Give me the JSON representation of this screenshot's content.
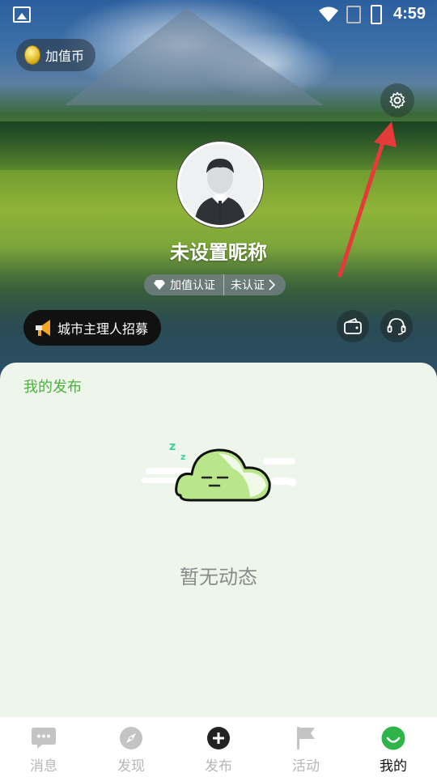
{
  "status_bar": {
    "time": "4:59"
  },
  "header": {
    "coin_label": "加值币",
    "nickname": "未设置昵称",
    "verify": {
      "label": "加值认证",
      "status": "未认证"
    },
    "recruit_label": "城市主理人招募"
  },
  "panel": {
    "title": "我的发布",
    "empty_text": "暂无动态"
  },
  "nav": [
    {
      "label": "消息",
      "icon": "chat-bubble-icon",
      "active": false
    },
    {
      "label": "发现",
      "icon": "compass-icon",
      "active": false
    },
    {
      "label": "发布",
      "icon": "plus-circle-icon",
      "active": false
    },
    {
      "label": "活动",
      "icon": "flag-icon",
      "active": false
    },
    {
      "label": "我的",
      "icon": "smile-face-icon",
      "active": true
    }
  ],
  "colors": {
    "accent": "#4caf3e",
    "arrow": "#e53a3a",
    "panel_bg": "#eef6ec"
  }
}
